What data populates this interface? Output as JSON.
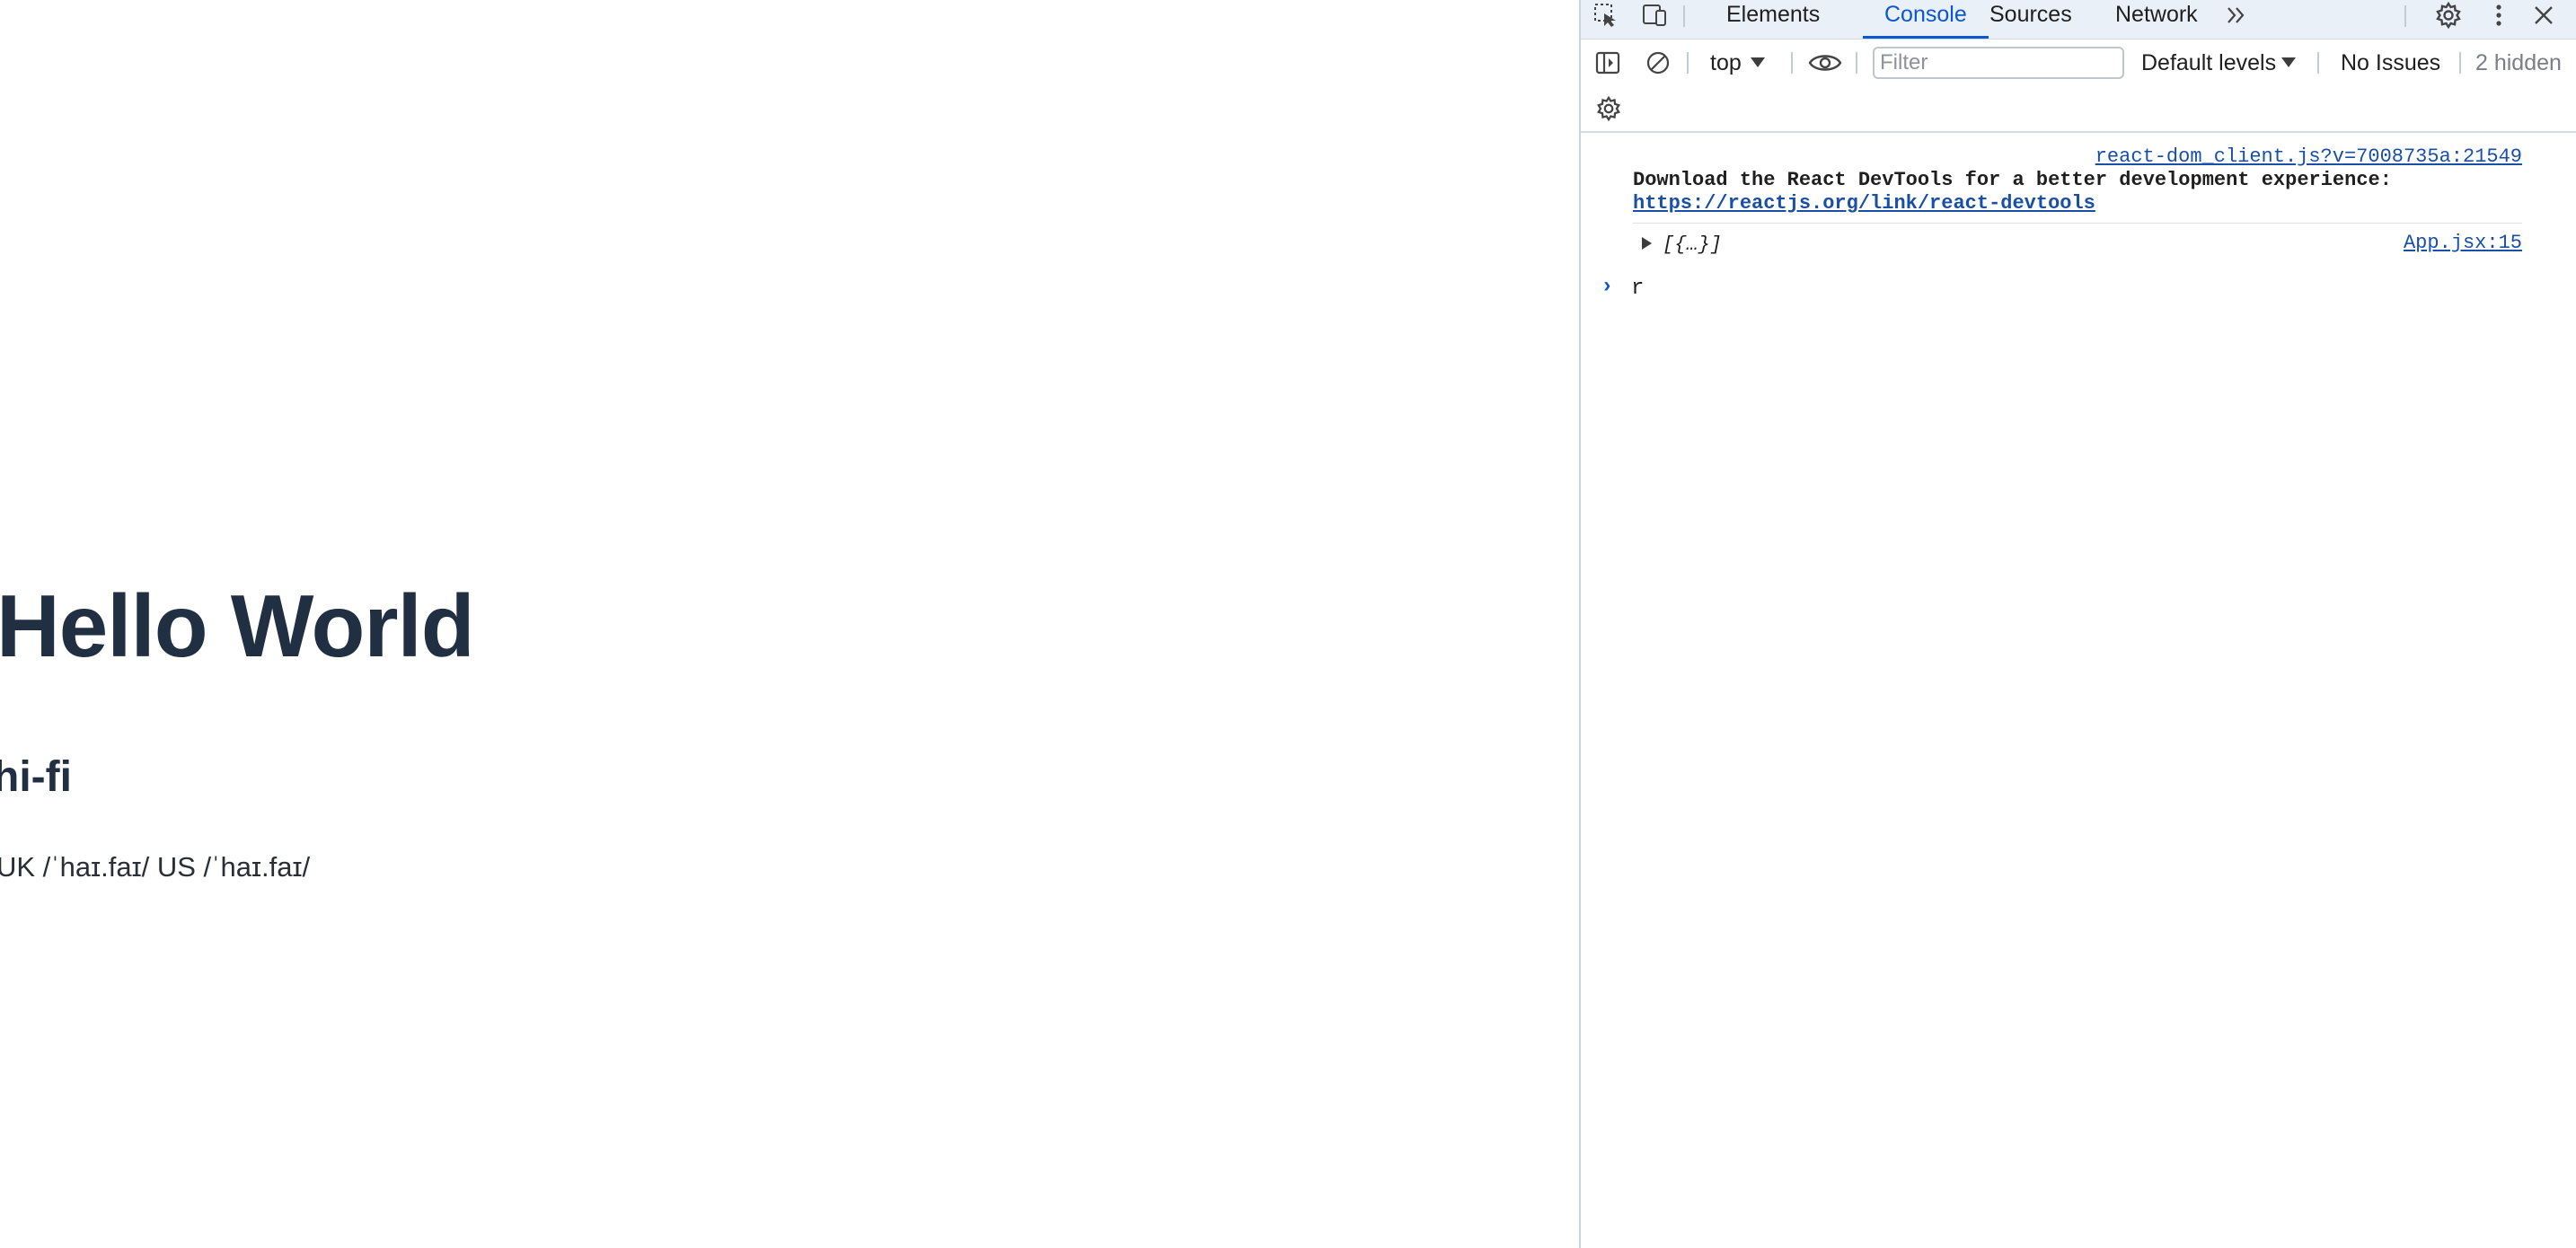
{
  "page": {
    "heading": "Hello World",
    "word": "hi-fi",
    "pronunciation": "UK /ˈhaɪ.faɪ/ US /ˈhaɪ.faɪ/"
  },
  "devtools": {
    "tabs": [
      {
        "label": "Elements"
      },
      {
        "label": "Console"
      },
      {
        "label": "Sources"
      },
      {
        "label": "Network"
      }
    ],
    "active_tab": "Console",
    "icons": {
      "inspect": "inspect-element-icon",
      "device": "device-toolbar-icon",
      "more_tabs": "chevron-double-right-icon",
      "settings": "gear-icon",
      "menu": "kebab-menu-icon",
      "close": "close-icon",
      "sidebar": "sidebar-toggle-icon",
      "clear": "clear-console-icon",
      "eye": "eye-icon",
      "console_settings": "gear-icon"
    },
    "toolbar": {
      "context": "top",
      "filter_placeholder": "Filter",
      "filter_value": "",
      "levels": "Default levels",
      "issues": "No Issues",
      "hidden": "2 hidden"
    },
    "messages": [
      {
        "source": "react-dom_client.js?v=7008735a:21549",
        "text": "Download the React DevTools for a better development experience:",
        "link": "https://reactjs.org/link/react-devtools"
      },
      {
        "source": "App.jsx:15",
        "object": "[{…}]"
      }
    ],
    "prompt_input": "r"
  },
  "colors": {
    "heading": "#212f43",
    "accent": "#0b57d0",
    "link": "#1a4fa8",
    "tabbar_bg": "#eaf0f7"
  }
}
